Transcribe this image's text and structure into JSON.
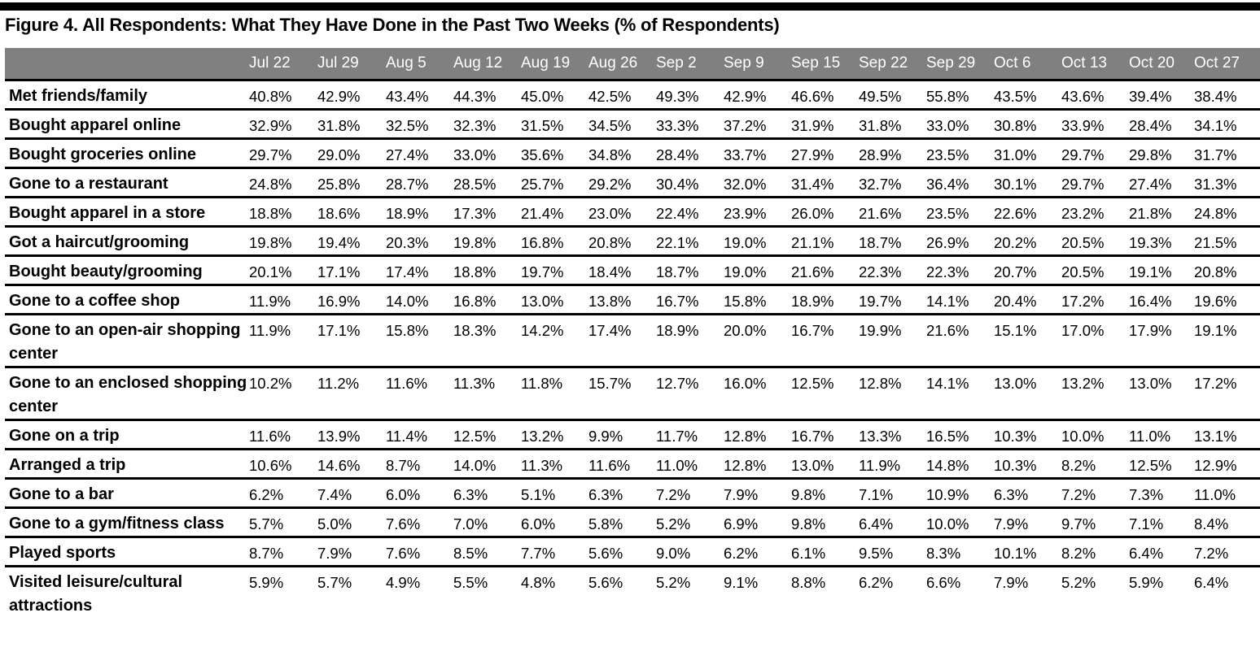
{
  "title": "Figure 4. All Respondents: What They Have Done in the Past Two Weeks (% of Respondents)",
  "chart_data": {
    "type": "table",
    "title": "Figure 4. All Respondents: What They Have Done in the Past Two Weeks (% of Respondents)",
    "columns": [
      "Jul 22",
      "Jul 29",
      "Aug 5",
      "Aug 12",
      "Aug 19",
      "Aug 26",
      "Sep 2",
      "Sep 9",
      "Sep 15",
      "Sep 22",
      "Sep 29",
      "Oct 6",
      "Oct 13",
      "Oct 20",
      "Oct 27"
    ],
    "rows": [
      {
        "label": "Met friends/family",
        "values": [
          "40.8%",
          "42.9%",
          "43.4%",
          "44.3%",
          "45.0%",
          "42.5%",
          "49.3%",
          "42.9%",
          "46.6%",
          "49.5%",
          "55.8%",
          "43.5%",
          "43.6%",
          "39.4%",
          "38.4%"
        ]
      },
      {
        "label": "Bought apparel online",
        "values": [
          "32.9%",
          "31.8%",
          "32.5%",
          "32.3%",
          "31.5%",
          "34.5%",
          "33.3%",
          "37.2%",
          "31.9%",
          "31.8%",
          "33.0%",
          "30.8%",
          "33.9%",
          "28.4%",
          "34.1%"
        ]
      },
      {
        "label": "Bought groceries online",
        "values": [
          "29.7%",
          "29.0%",
          "27.4%",
          "33.0%",
          "35.6%",
          "34.8%",
          "28.4%",
          "33.7%",
          "27.9%",
          "28.9%",
          "23.5%",
          "31.0%",
          "29.7%",
          "29.8%",
          "31.7%"
        ]
      },
      {
        "label": "Gone to a restaurant",
        "values": [
          "24.8%",
          "25.8%",
          "28.7%",
          "28.5%",
          "25.7%",
          "29.2%",
          "30.4%",
          "32.0%",
          "31.4%",
          "32.7%",
          "36.4%",
          "30.1%",
          "29.7%",
          "27.4%",
          "31.3%"
        ]
      },
      {
        "label": "Bought apparel in a store",
        "values": [
          "18.8%",
          "18.6%",
          "18.9%",
          "17.3%",
          "21.4%",
          "23.0%",
          "22.4%",
          "23.9%",
          "26.0%",
          "21.6%",
          "23.5%",
          "22.6%",
          "23.2%",
          "21.8%",
          "24.8%"
        ]
      },
      {
        "label": "Got a haircut/grooming",
        "values": [
          "19.8%",
          "19.4%",
          "20.3%",
          "19.8%",
          "16.8%",
          "20.8%",
          "22.1%",
          "19.0%",
          "21.1%",
          "18.7%",
          "26.9%",
          "20.2%",
          "20.5%",
          "19.3%",
          "21.5%"
        ]
      },
      {
        "label": "Bought beauty/grooming",
        "values": [
          "20.1%",
          "17.1%",
          "17.4%",
          "18.8%",
          "19.7%",
          "18.4%",
          "18.7%",
          "19.0%",
          "21.6%",
          "22.3%",
          "22.3%",
          "20.7%",
          "20.5%",
          "19.1%",
          "20.8%"
        ]
      },
      {
        "label": "Gone to a coffee shop",
        "values": [
          "11.9%",
          "16.9%",
          "14.0%",
          "16.8%",
          "13.0%",
          "13.8%",
          "16.7%",
          "15.8%",
          "18.9%",
          "19.7%",
          "14.1%",
          "20.4%",
          "17.2%",
          "16.4%",
          "19.6%"
        ]
      },
      {
        "label": "Gone to an open-air shopping center",
        "values": [
          "11.9%",
          "17.1%",
          "15.8%",
          "18.3%",
          "14.2%",
          "17.4%",
          "18.9%",
          "20.0%",
          "16.7%",
          "19.9%",
          "21.6%",
          "15.1%",
          "17.0%",
          "17.9%",
          "19.1%"
        ]
      },
      {
        "label": "Gone to an enclosed shopping center",
        "values": [
          "10.2%",
          "11.2%",
          "11.6%",
          "11.3%",
          "11.8%",
          "15.7%",
          "12.7%",
          "16.0%",
          "12.5%",
          "12.8%",
          "14.1%",
          "13.0%",
          "13.2%",
          "13.0%",
          "17.2%"
        ]
      },
      {
        "label": "Gone on a trip",
        "values": [
          "11.6%",
          "13.9%",
          "11.4%",
          "12.5%",
          "13.2%",
          "9.9%",
          "11.7%",
          "12.8%",
          "16.7%",
          "13.3%",
          "16.5%",
          "10.3%",
          "10.0%",
          "11.0%",
          "13.1%"
        ]
      },
      {
        "label": "Arranged a trip",
        "values": [
          "10.6%",
          "14.6%",
          "8.7%",
          "14.0%",
          "11.3%",
          "11.6%",
          "11.0%",
          "12.8%",
          "13.0%",
          "11.9%",
          "14.8%",
          "10.3%",
          "8.2%",
          "12.5%",
          "12.9%"
        ]
      },
      {
        "label": "Gone to a bar",
        "values": [
          "6.2%",
          "7.4%",
          "6.0%",
          "6.3%",
          "5.1%",
          "6.3%",
          "7.2%",
          "7.9%",
          "9.8%",
          "7.1%",
          "10.9%",
          "6.3%",
          "7.2%",
          "7.3%",
          "11.0%"
        ]
      },
      {
        "label": "Gone to a gym/fitness class",
        "values": [
          "5.7%",
          "5.0%",
          "7.6%",
          "7.0%",
          "6.0%",
          "5.8%",
          "5.2%",
          "6.9%",
          "9.8%",
          "6.4%",
          "10.0%",
          "7.9%",
          "9.7%",
          "7.1%",
          "8.4%"
        ]
      },
      {
        "label": "Played sports",
        "values": [
          "8.7%",
          "7.9%",
          "7.6%",
          "8.5%",
          "7.7%",
          "5.6%",
          "9.0%",
          "6.2%",
          "6.1%",
          "9.5%",
          "8.3%",
          "10.1%",
          "8.2%",
          "6.4%",
          "7.2%"
        ]
      },
      {
        "label": "Visited leisure/cultural attractions",
        "values": [
          "5.9%",
          "5.7%",
          "4.9%",
          "5.5%",
          "4.8%",
          "5.6%",
          "5.2%",
          "9.1%",
          "8.8%",
          "6.2%",
          "6.6%",
          "7.9%",
          "5.2%",
          "5.9%",
          "6.4%"
        ]
      }
    ]
  },
  "colors": {
    "header_bg": "#808080",
    "header_text": "#ffffff",
    "rule": "#000000"
  }
}
